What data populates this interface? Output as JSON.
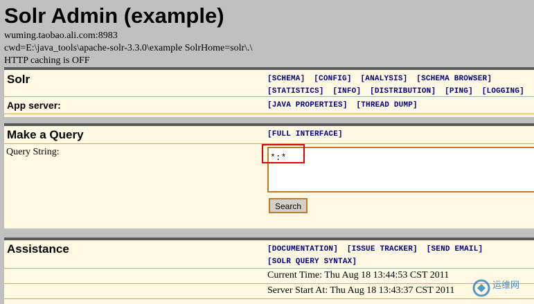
{
  "page": {
    "title": "Solr Admin (example)",
    "host": "wuming.taobao.ali.com:8983",
    "cwd": "cwd=E:\\java_tools\\apache-solr-3.3.0\\example SolrHome=solr\\.\\",
    "caching": "HTTP caching is OFF"
  },
  "solr_panel": {
    "heading": "Solr",
    "links_row1": [
      "[SCHEMA]",
      "[CONFIG]",
      "[ANALYSIS]",
      "[SCHEMA BROWSER]"
    ],
    "links_row2": [
      "[STATISTICS]",
      "[INFO]",
      "[DISTRIBUTION]",
      "[PING]",
      "[LOGGING]"
    ],
    "app_server_label": "App server:",
    "app_server_links": [
      "[JAVA PROPERTIES]",
      "[THREAD DUMP]"
    ]
  },
  "query_panel": {
    "heading": "Make a Query",
    "full_interface": "[FULL INTERFACE]",
    "query_label": "Query String:",
    "query_value": "*:*",
    "search_label": "Search"
  },
  "assistance_panel": {
    "heading": "Assistance",
    "links_row1": [
      "[DOCUMENTATION]",
      "[ISSUE TRACKER]",
      "[SEND EMAIL]"
    ],
    "links_row2": [
      "[SOLR QUERY SYNTAX]"
    ],
    "current_time": "Current Time: Thu Aug 18 13:44:53 CST 2011",
    "server_start": "Server Start At: Thu Aug 18 13:43:37 CST 2011"
  },
  "colors": {
    "panel_bg": "#fff8e3",
    "panel_border": "#5a5a5a",
    "link": "#000080",
    "highlight": "#e00000"
  },
  "watermark": {
    "text": "运维网",
    "icon": "watermark-logo-icon"
  }
}
